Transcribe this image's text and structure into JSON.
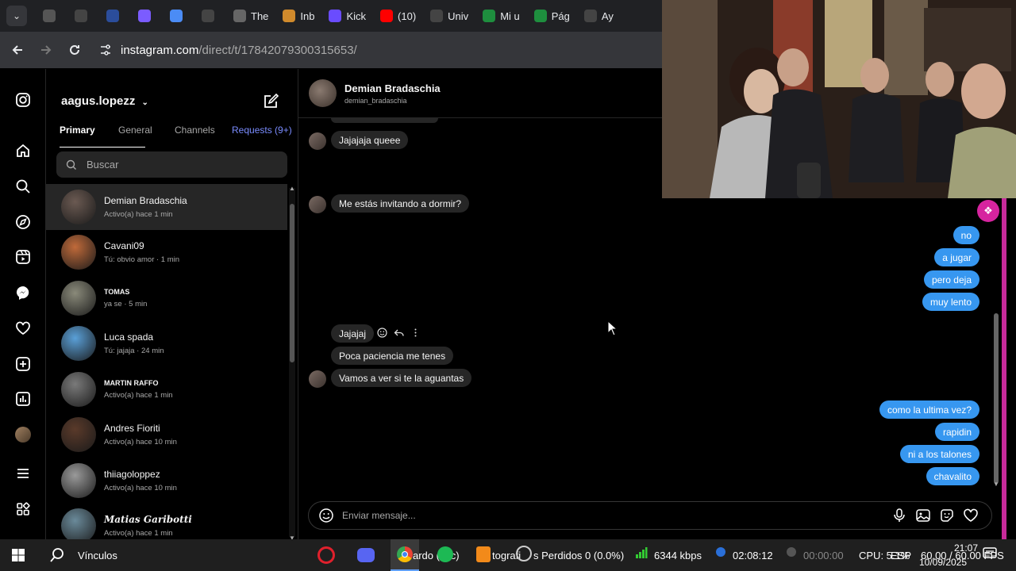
{
  "browser": {
    "tabs": [
      {
        "label": "",
        "icon": "fig-icon",
        "color": "#555555"
      },
      {
        "label": "",
        "icon": "chatgpt-icon",
        "color": "#444444"
      },
      {
        "label": "",
        "icon": "globe-icon",
        "color": "#2b4d9b"
      },
      {
        "label": "",
        "icon": "s-icon",
        "color": "#7b5cff"
      },
      {
        "label": "",
        "icon": "sparkle-icon",
        "color": "#4b8cf5"
      },
      {
        "label": "",
        "icon": "chatgpt-icon",
        "color": "#444444"
      },
      {
        "label": "The",
        "icon": "pentagon-icon",
        "color": "#666666"
      },
      {
        "label": "Inb",
        "icon": "inbox-icon",
        "color": "#d08a2c"
      },
      {
        "label": "Kick",
        "icon": "kick-icon",
        "color": "#6a4cff"
      },
      {
        "label": "(10)",
        "icon": "youtube-icon",
        "color": "#ff0000"
      },
      {
        "label": "Univ",
        "icon": "univ-icon",
        "color": "#444444"
      },
      {
        "label": "Mi u",
        "icon": "drive-icon",
        "color": "#1e8e3e"
      },
      {
        "label": "Pág",
        "icon": "drive-icon",
        "color": "#1e8e3e"
      },
      {
        "label": "Ay",
        "icon": "chatgpt-icon",
        "color": "#444444"
      }
    ],
    "url_host": "instagram.com",
    "url_path": "/direct/t/17842079300315653/"
  },
  "inbox": {
    "username": "aagus.lopezz",
    "tabs": [
      "Primary",
      "General",
      "Channels",
      "Requests (9+)"
    ],
    "search_placeholder": "Buscar",
    "conversations": [
      {
        "name": "Demian Bradaschia",
        "sub": "Activo(a) hace 1 min",
        "style": "normal",
        "avatar": "#6b5a52"
      },
      {
        "name": "Cavani09",
        "sub": "Tú: obvio amor · 1 min",
        "style": "normal",
        "avatar": "#c06a3a"
      },
      {
        "name": "TOMAS",
        "sub": "ya se · 5 min",
        "style": "small",
        "avatar": "#8a8a7a"
      },
      {
        "name": "Luca spada",
        "sub": "Tú: jajaja · 24 min",
        "style": "normal",
        "avatar": "#5aa0d8"
      },
      {
        "name": "MARTIN RAFFO",
        "sub": "Activo(a) hace 1 min",
        "style": "small",
        "avatar": "#7a7a7a"
      },
      {
        "name": "Andres Fioriti",
        "sub": "Activo(a) hace 10 min",
        "style": "normal",
        "avatar": "#5a3a2a"
      },
      {
        "name": "thiiagoloppez",
        "sub": "Activo(a) hace 10 min",
        "style": "normal",
        "avatar": "#9a9a9a"
      },
      {
        "name": "Matias Garibotti",
        "sub": "Activo(a) hace 1 min",
        "style": "script",
        "avatar": "#6a8a9a"
      }
    ]
  },
  "chat": {
    "contact_name": "Demian Bradaschia",
    "contact_username": "demian_bradaschia",
    "messages_in": [
      "Jajajaja queee",
      "Me estás invitando a dormir?",
      "Jajajaj",
      "Poca paciencia me tenes",
      "Vamos a ver si te la aguantas"
    ],
    "messages_out": [
      "no",
      "a jugar",
      "pero deja",
      "muy lento",
      "como la ultima vez?",
      "rapidin",
      "ni a los talones",
      "chavalito"
    ],
    "composer_placeholder": "Enviar mensaje..."
  },
  "taskbar": {
    "search_label": "Vínculos",
    "items": [
      {
        "label": "ardo (sec)"
      },
      {
        "label": "tografi"
      },
      {
        "label": "s Perdidos 0 (0.0%)"
      },
      {
        "label": "6344 kbps"
      },
      {
        "label": "02:08:12"
      },
      {
        "label": "00:00:00"
      },
      {
        "label": "CPU: 5.1%"
      },
      {
        "label": "60.00 / 60.00 FPS"
      }
    ],
    "language": "ESP",
    "time": "21:07",
    "date": "10/09/2025"
  },
  "colors": {
    "accent": "#3797f0",
    "incoming": "#262626",
    "brand": "#d6249f"
  }
}
